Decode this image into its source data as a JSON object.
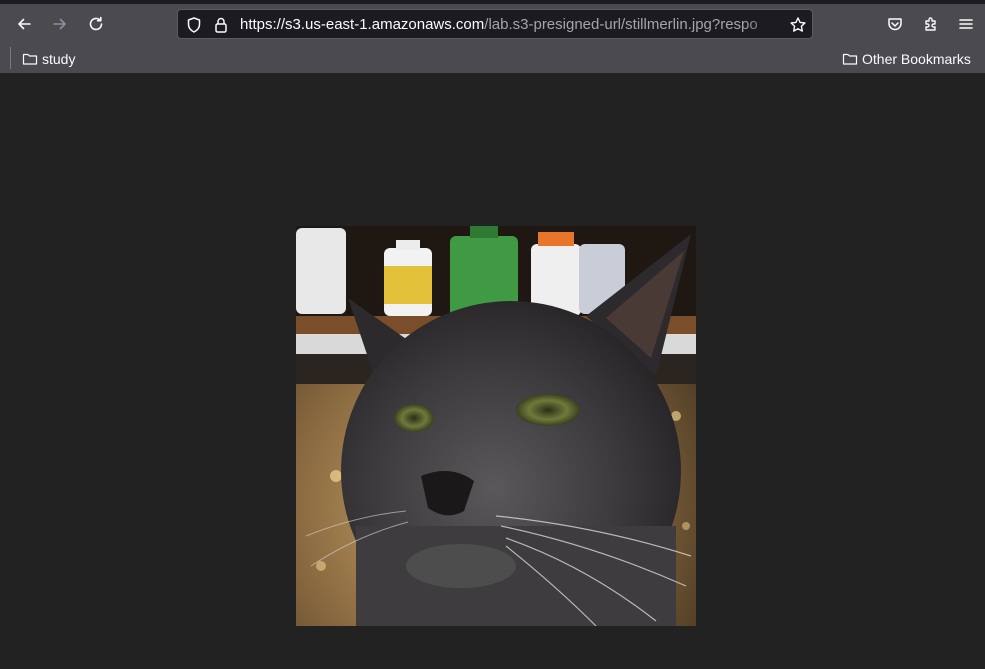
{
  "browser": {
    "url_host": "https://s3.us-east-1.amazonaws.com",
    "url_path": "/lab.s3-presigned-url/stillmerlin.jpg?respo",
    "bookmarks": [
      {
        "label": "study"
      },
      {
        "label": "Other Bookmarks"
      }
    ]
  },
  "icons": {
    "back": "back-arrow-icon",
    "forward": "forward-arrow-icon",
    "reload": "reload-icon",
    "shield": "shield-icon",
    "lock": "lock-icon",
    "bookmark_star": "star-icon",
    "pocket": "pocket-icon",
    "extensions": "puzzle-icon",
    "menu": "hamburger-menu-icon",
    "folder": "folder-icon"
  },
  "image": {
    "subject": "gray cat photo"
  },
  "colors": {
    "toolbar": "#4a4a4f",
    "urlbar": "#1c1b22",
    "page_bg": "#222222"
  }
}
